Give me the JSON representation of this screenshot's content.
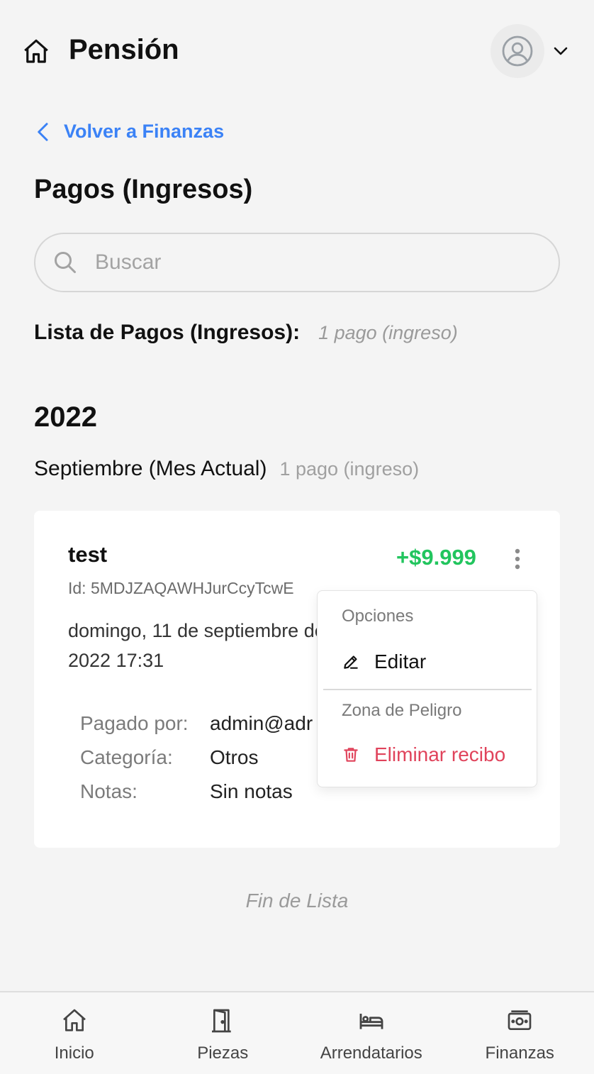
{
  "header": {
    "title": "Pensión",
    "home_icon": "house-icon",
    "avatar_icon": "user-circle-icon",
    "menu_icon": "chevron-down-icon"
  },
  "back_link": {
    "label": "Volver a Finanzas",
    "icon": "chevron-left-icon"
  },
  "page_title": "Pagos (Ingresos)",
  "search": {
    "placeholder": "Buscar",
    "value": "",
    "icon": "search-icon"
  },
  "list": {
    "title": "Lista de Pagos (Ingresos):",
    "count": "1 pago (ingreso)"
  },
  "year": "2022",
  "month": {
    "title": "Septiembre (Mes Actual)",
    "count": "1 pago (ingreso)"
  },
  "payment": {
    "title": "test",
    "amount": "+$9.999",
    "id": "Id: 5MDJZAQAWHJurCcyTcwE",
    "date": "domingo, 11 de septiembre de 2022 17:31",
    "details": [
      {
        "label": "Pagado por:",
        "value": "admin@adr"
      },
      {
        "label": "Categoría:",
        "value": "Otros"
      },
      {
        "label": "Notas:",
        "value": "Sin notas"
      }
    ]
  },
  "menu": {
    "section_options": "Opciones",
    "edit_label": "Editar",
    "section_danger": "Zona de Peligro",
    "delete_label": "Eliminar recibo"
  },
  "end_of_list": "Fin de Lista",
  "nav": [
    {
      "label": "Inicio",
      "icon": "house-icon"
    },
    {
      "label": "Piezas",
      "icon": "door-icon"
    },
    {
      "label": "Arrendatarios",
      "icon": "bed-icon"
    },
    {
      "label": "Finanzas",
      "icon": "banknote-icon"
    }
  ],
  "colors": {
    "accent": "#3b82f6",
    "amount_positive": "#22c55e",
    "danger": "#e0435b",
    "background": "#f4f4f4"
  }
}
